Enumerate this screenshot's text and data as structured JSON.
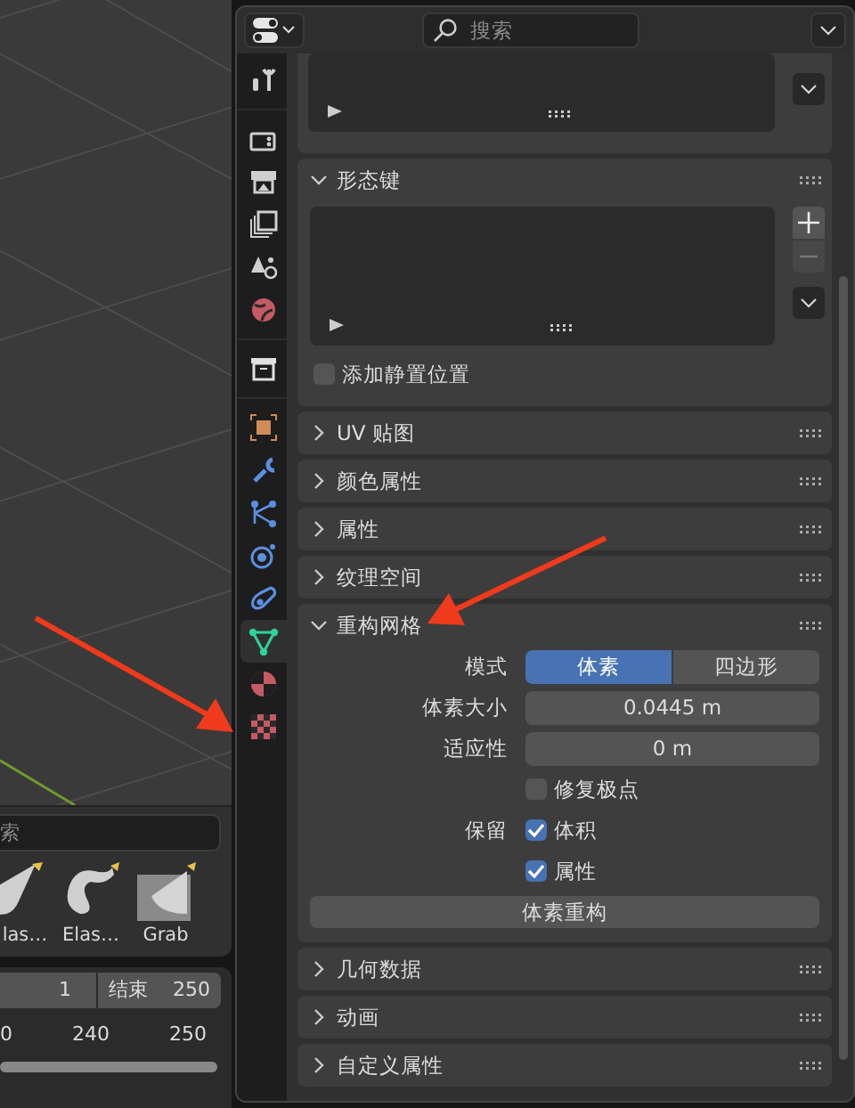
{
  "asset_shelf": {
    "search": {
      "value": "索"
    },
    "assets": [
      {
        "label": "las…",
        "kind": "cone"
      },
      {
        "label": "Elas…",
        "kind": "hook"
      },
      {
        "label": "Grab",
        "kind": "square"
      }
    ]
  },
  "timeline": {
    "start": "1",
    "end_label": "结束",
    "end": "250",
    "ticks": [
      "0",
      "240",
      "250"
    ]
  },
  "properties": {
    "search": {
      "placeholder": "搜索"
    },
    "tabs": [
      {
        "kind": "tool",
        "selected": false,
        "separator_before": false
      },
      {
        "kind": "render",
        "selected": false,
        "separator_before": true
      },
      {
        "kind": "output",
        "selected": false,
        "separator_before": false
      },
      {
        "kind": "view_layer",
        "selected": false,
        "separator_before": false
      },
      {
        "kind": "scene",
        "selected": false,
        "separator_before": false
      },
      {
        "kind": "world",
        "selected": false,
        "separator_before": false
      },
      {
        "kind": "collection",
        "selected": false,
        "separator_before": true
      },
      {
        "kind": "object",
        "selected": false,
        "separator_before": true
      },
      {
        "kind": "modifier",
        "selected": false,
        "separator_before": false
      },
      {
        "kind": "particles",
        "selected": false,
        "separator_before": false
      },
      {
        "kind": "physics",
        "selected": false,
        "separator_before": false
      },
      {
        "kind": "constraints",
        "selected": false,
        "separator_before": false
      },
      {
        "kind": "data",
        "selected": true,
        "separator_before": false
      },
      {
        "kind": "material",
        "selected": false,
        "separator_before": false
      },
      {
        "kind": "texture",
        "selected": false,
        "separator_before": false
      }
    ],
    "panels": [
      {
        "kind": "list_tail"
      },
      {
        "kind": "shape_keys",
        "title": "形态键",
        "expanded": true,
        "checkbox": {
          "label": "添加静置位置",
          "checked": false
        }
      },
      {
        "kind": "plain",
        "title": "UV 贴图",
        "expanded": false
      },
      {
        "kind": "plain",
        "title": "颜色属性",
        "expanded": false
      },
      {
        "kind": "plain",
        "title": "属性",
        "expanded": false
      },
      {
        "kind": "plain",
        "title": "纹理空间",
        "expanded": false
      },
      {
        "kind": "remesh",
        "title": "重构网格",
        "expanded": true,
        "mode": {
          "label": "模式",
          "options": [
            {
              "label": "体素",
              "selected": true
            },
            {
              "label": "四边形",
              "selected": false
            }
          ]
        },
        "fields": [
          {
            "label": "体素大小",
            "value": "0.0445 m"
          },
          {
            "label": "适应性",
            "value": "0 m"
          }
        ],
        "fix_poles": {
          "label": "修复极点",
          "checked": false
        },
        "preserve": {
          "label": "保留",
          "options": [
            {
              "label": "体积",
              "checked": true
            },
            {
              "label": "属性",
              "checked": true
            }
          ]
        },
        "button": "体素重构"
      },
      {
        "kind": "plain",
        "title": "几何数据",
        "expanded": false
      },
      {
        "kind": "plain",
        "title": "动画",
        "expanded": false
      },
      {
        "kind": "plain",
        "title": "自定义属性",
        "expanded": false
      }
    ]
  }
}
